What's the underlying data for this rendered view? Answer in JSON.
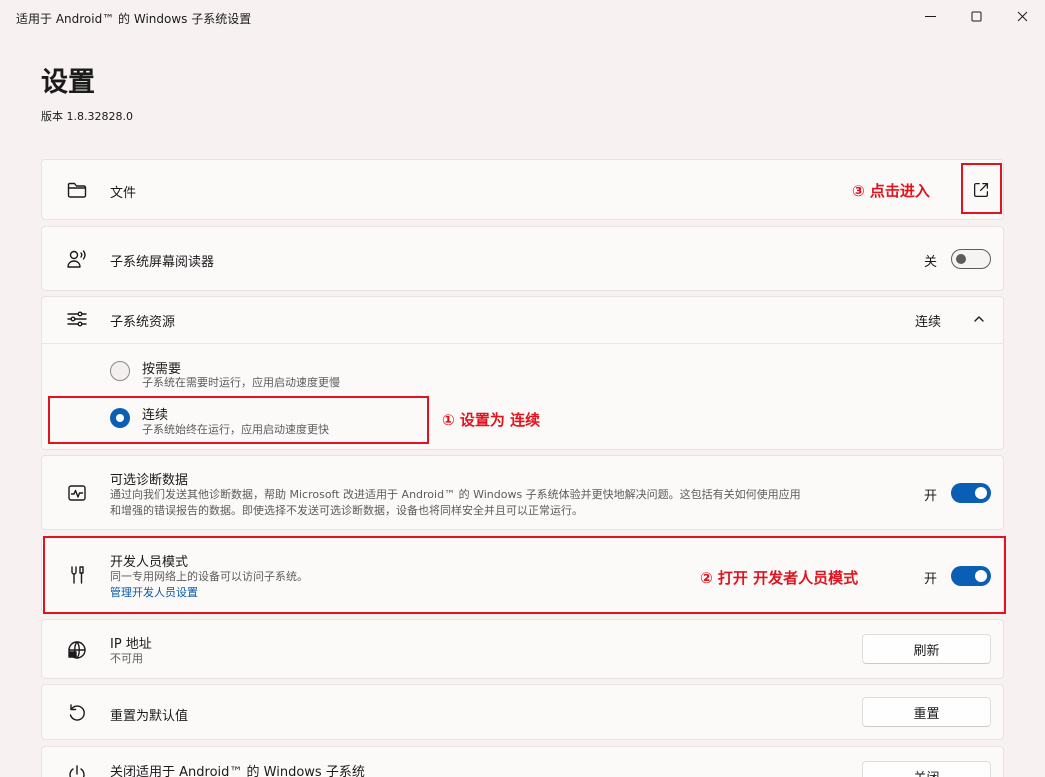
{
  "window": {
    "title": "适用于 Android™ 的 Windows 子系统设置"
  },
  "page": {
    "title": "设置",
    "version": "版本 1.8.32828.0"
  },
  "files": {
    "label": "文件",
    "icon": "folder-icon",
    "action_icon": "open-external-icon"
  },
  "screen_reader": {
    "label": "子系统屏幕阅读器",
    "state": "关",
    "toggle_on": false
  },
  "resources": {
    "label": "子系统资源",
    "selected_value": "连续",
    "options": [
      {
        "label": "按需要",
        "desc": "子系统在需要时运行，应用启动速度更慢",
        "selected": false
      },
      {
        "label": "连续",
        "desc": "子系统始终在运行，应用启动速度更快",
        "selected": true
      }
    ]
  },
  "diagnostics": {
    "label": "可选诊断数据",
    "desc_line1": "通过向我们发送其他诊断数据，帮助 Microsoft 改进适用于 Android™ 的 Windows 子系统体验并更快地解决问题。这包括有关如何使用应用",
    "desc_line2": "和增强的错误报告的数据。即使选择不发送可选诊断数据，设备也将同样安全并且可以正常运行。",
    "state": "开",
    "toggle_on": true
  },
  "developer": {
    "label": "开发人员模式",
    "desc": "同一专用网络上的设备可以访问子系统。",
    "link": "管理开发人员设置",
    "state": "开",
    "toggle_on": true
  },
  "ip": {
    "label": "IP 地址",
    "value": "不可用",
    "button": "刷新"
  },
  "reset": {
    "label": "重置为默认值",
    "button": "重置"
  },
  "shutdown": {
    "label": "关闭适用于 Android™ 的 Windows 子系统",
    "button": "关闭"
  },
  "annotations": {
    "step1": "① 设置为 连续",
    "step2": "② 打开 开发者人员模式",
    "step3": "③ 点击进入",
    "color": "#e0141e"
  },
  "colors": {
    "accent": "#0a5fb4",
    "background": "#f7f1f2",
    "card": "#fcf9f9"
  }
}
